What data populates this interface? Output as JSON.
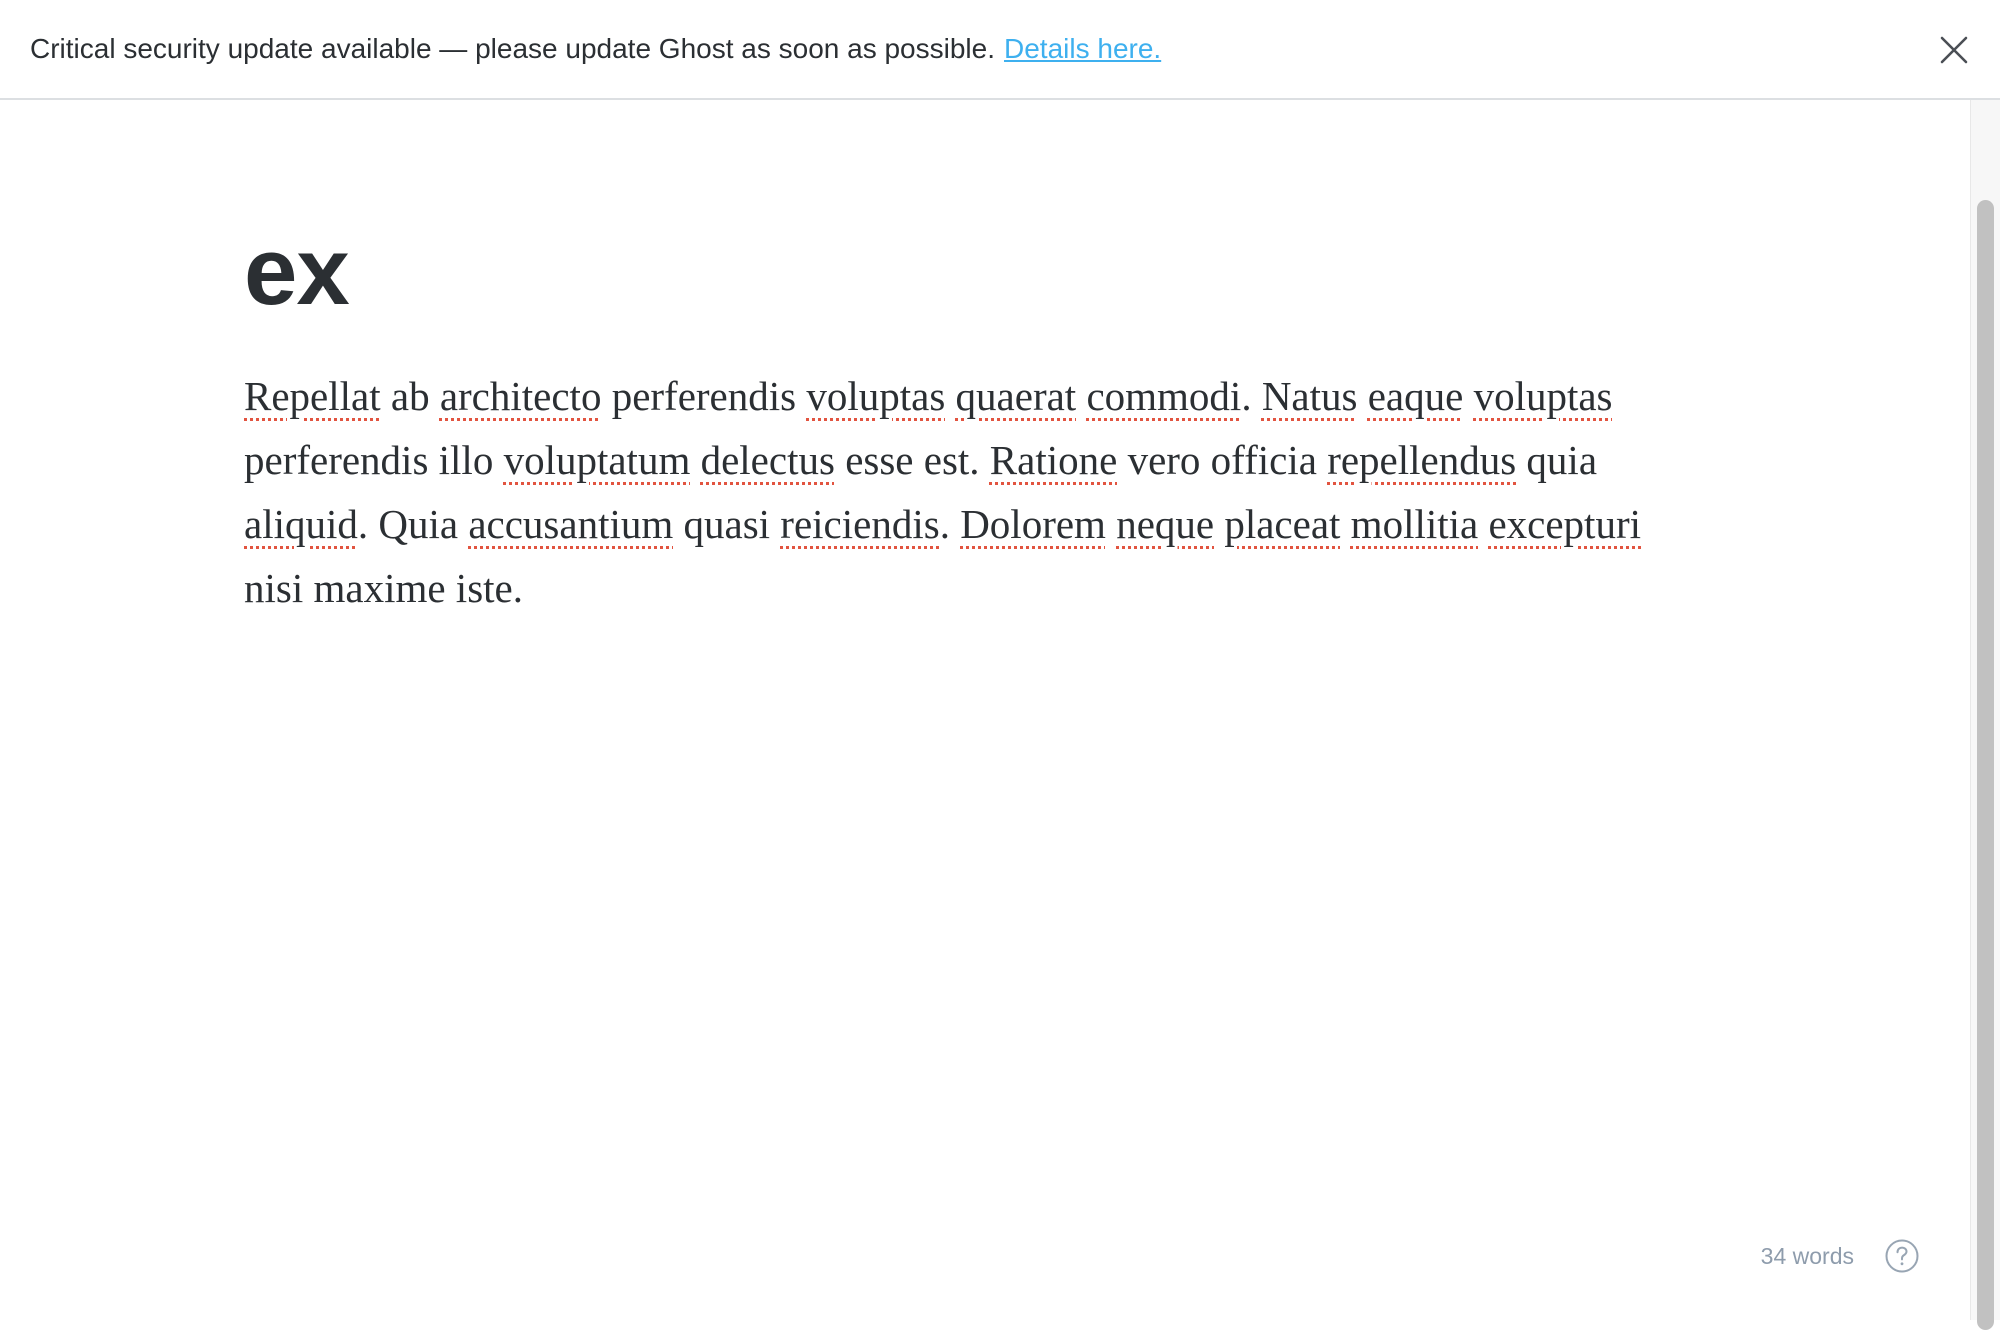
{
  "banner": {
    "message": "Critical security update available — please update Ghost as soon as possible.",
    "link_label": "Details here.",
    "close_icon": "close-icon",
    "link_color": "#3eb0ef"
  },
  "post": {
    "title": "ex",
    "body_segments": [
      {
        "text": "Repellat",
        "misspelled": true
      },
      {
        "text": " ab ",
        "misspelled": false
      },
      {
        "text": "architecto",
        "misspelled": true
      },
      {
        "text": " perferendis ",
        "misspelled": false
      },
      {
        "text": "voluptas",
        "misspelled": true
      },
      {
        "text": " ",
        "misspelled": false
      },
      {
        "text": "quaerat",
        "misspelled": true
      },
      {
        "text": " ",
        "misspelled": false
      },
      {
        "text": "commodi",
        "misspelled": true
      },
      {
        "text": ". ",
        "misspelled": false
      },
      {
        "text": "Natus",
        "misspelled": true
      },
      {
        "text": " ",
        "misspelled": false
      },
      {
        "text": "eaque",
        "misspelled": true
      },
      {
        "text": " ",
        "misspelled": false
      },
      {
        "text": "voluptas",
        "misspelled": true
      },
      {
        "text": " perferendis illo ",
        "misspelled": false
      },
      {
        "text": "voluptatum",
        "misspelled": true
      },
      {
        "text": " ",
        "misspelled": false
      },
      {
        "text": "delectus",
        "misspelled": true
      },
      {
        "text": " esse est. ",
        "misspelled": false
      },
      {
        "text": "Ratione",
        "misspelled": true
      },
      {
        "text": " vero officia ",
        "misspelled": false
      },
      {
        "text": "repellendus",
        "misspelled": true
      },
      {
        "text": " quia ",
        "misspelled": false
      },
      {
        "text": "aliquid",
        "misspelled": true
      },
      {
        "text": ". Quia ",
        "misspelled": false
      },
      {
        "text": "accusantium",
        "misspelled": true
      },
      {
        "text": " quasi ",
        "misspelled": false
      },
      {
        "text": "reiciendis",
        "misspelled": true
      },
      {
        "text": ". ",
        "misspelled": false
      },
      {
        "text": "Dolorem",
        "misspelled": true
      },
      {
        "text": " ",
        "misspelled": false
      },
      {
        "text": "neque",
        "misspelled": true
      },
      {
        "text": " ",
        "misspelled": false
      },
      {
        "text": "placeat",
        "misspelled": true
      },
      {
        "text": " ",
        "misspelled": false
      },
      {
        "text": "mollitia",
        "misspelled": true
      },
      {
        "text": " ",
        "misspelled": false
      },
      {
        "text": "excepturi",
        "misspelled": true
      },
      {
        "text": " nisi maxime iste.",
        "misspelled": false
      }
    ],
    "spellcheck_color": "#e25440"
  },
  "status": {
    "word_count": "34 words",
    "help_icon": "question-circle-icon"
  }
}
